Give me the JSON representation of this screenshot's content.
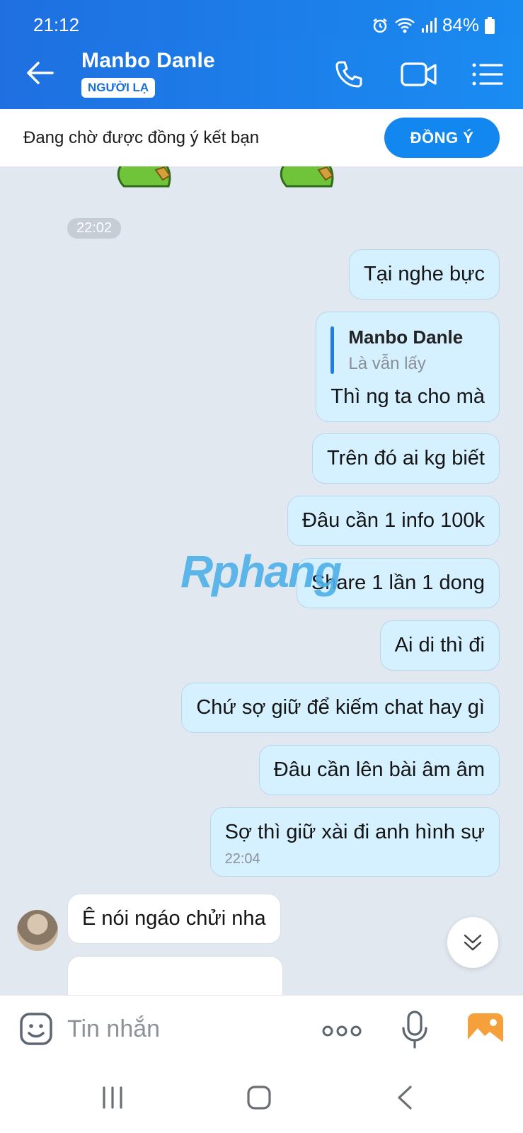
{
  "status_bar": {
    "time": "21:12",
    "battery": "84%"
  },
  "header": {
    "contact_name": "Manbo Danle",
    "badge": "NGƯỜI LẠ"
  },
  "friend_request": {
    "text": "Đang chờ được đồng ý kết bạn",
    "accept_label": "ĐỒNG Ý"
  },
  "chat": {
    "time_chip": "22:02",
    "messages": [
      {
        "text": "Tại nghe bực"
      },
      {
        "quote_name": "Manbo Danle",
        "quote_text": "Là vẫn lấy",
        "text": "Thì ng ta cho mà"
      },
      {
        "text": "Trên đó ai kg biết"
      },
      {
        "text": "Đâu cần 1 info 100k"
      },
      {
        "text": "Share 1 lần 1 dong"
      },
      {
        "text": "Ai di thì đi"
      },
      {
        "text": "Chứ sợ giữ để kiếm chat hay gì"
      },
      {
        "text": "Đâu cần lên bài âm âm"
      },
      {
        "text": "Sợ thì giữ xài đi anh hình sự",
        "time": "22:04"
      }
    ],
    "incoming": [
      {
        "text": "Ê nói ngáo chửi nha"
      },
      {
        "text": ""
      }
    ]
  },
  "watermark": "Rphang",
  "composer": {
    "placeholder": "Tin nhắn"
  },
  "icons": {
    "back": "arrow-left-icon",
    "call": "phone-icon",
    "video": "video-camera-icon",
    "menu": "list-menu-icon",
    "emoji": "sticker-emoji-icon",
    "more": "more-dots-icon",
    "mic": "microphone-icon",
    "image": "image-icon",
    "scroll": "chevron-double-down-icon"
  },
  "colors": {
    "header": "#1a7ce8",
    "outgoing_bubble": "#d5f0ff",
    "accent": "#1287f0",
    "chat_bg": "#e2e8f0"
  }
}
